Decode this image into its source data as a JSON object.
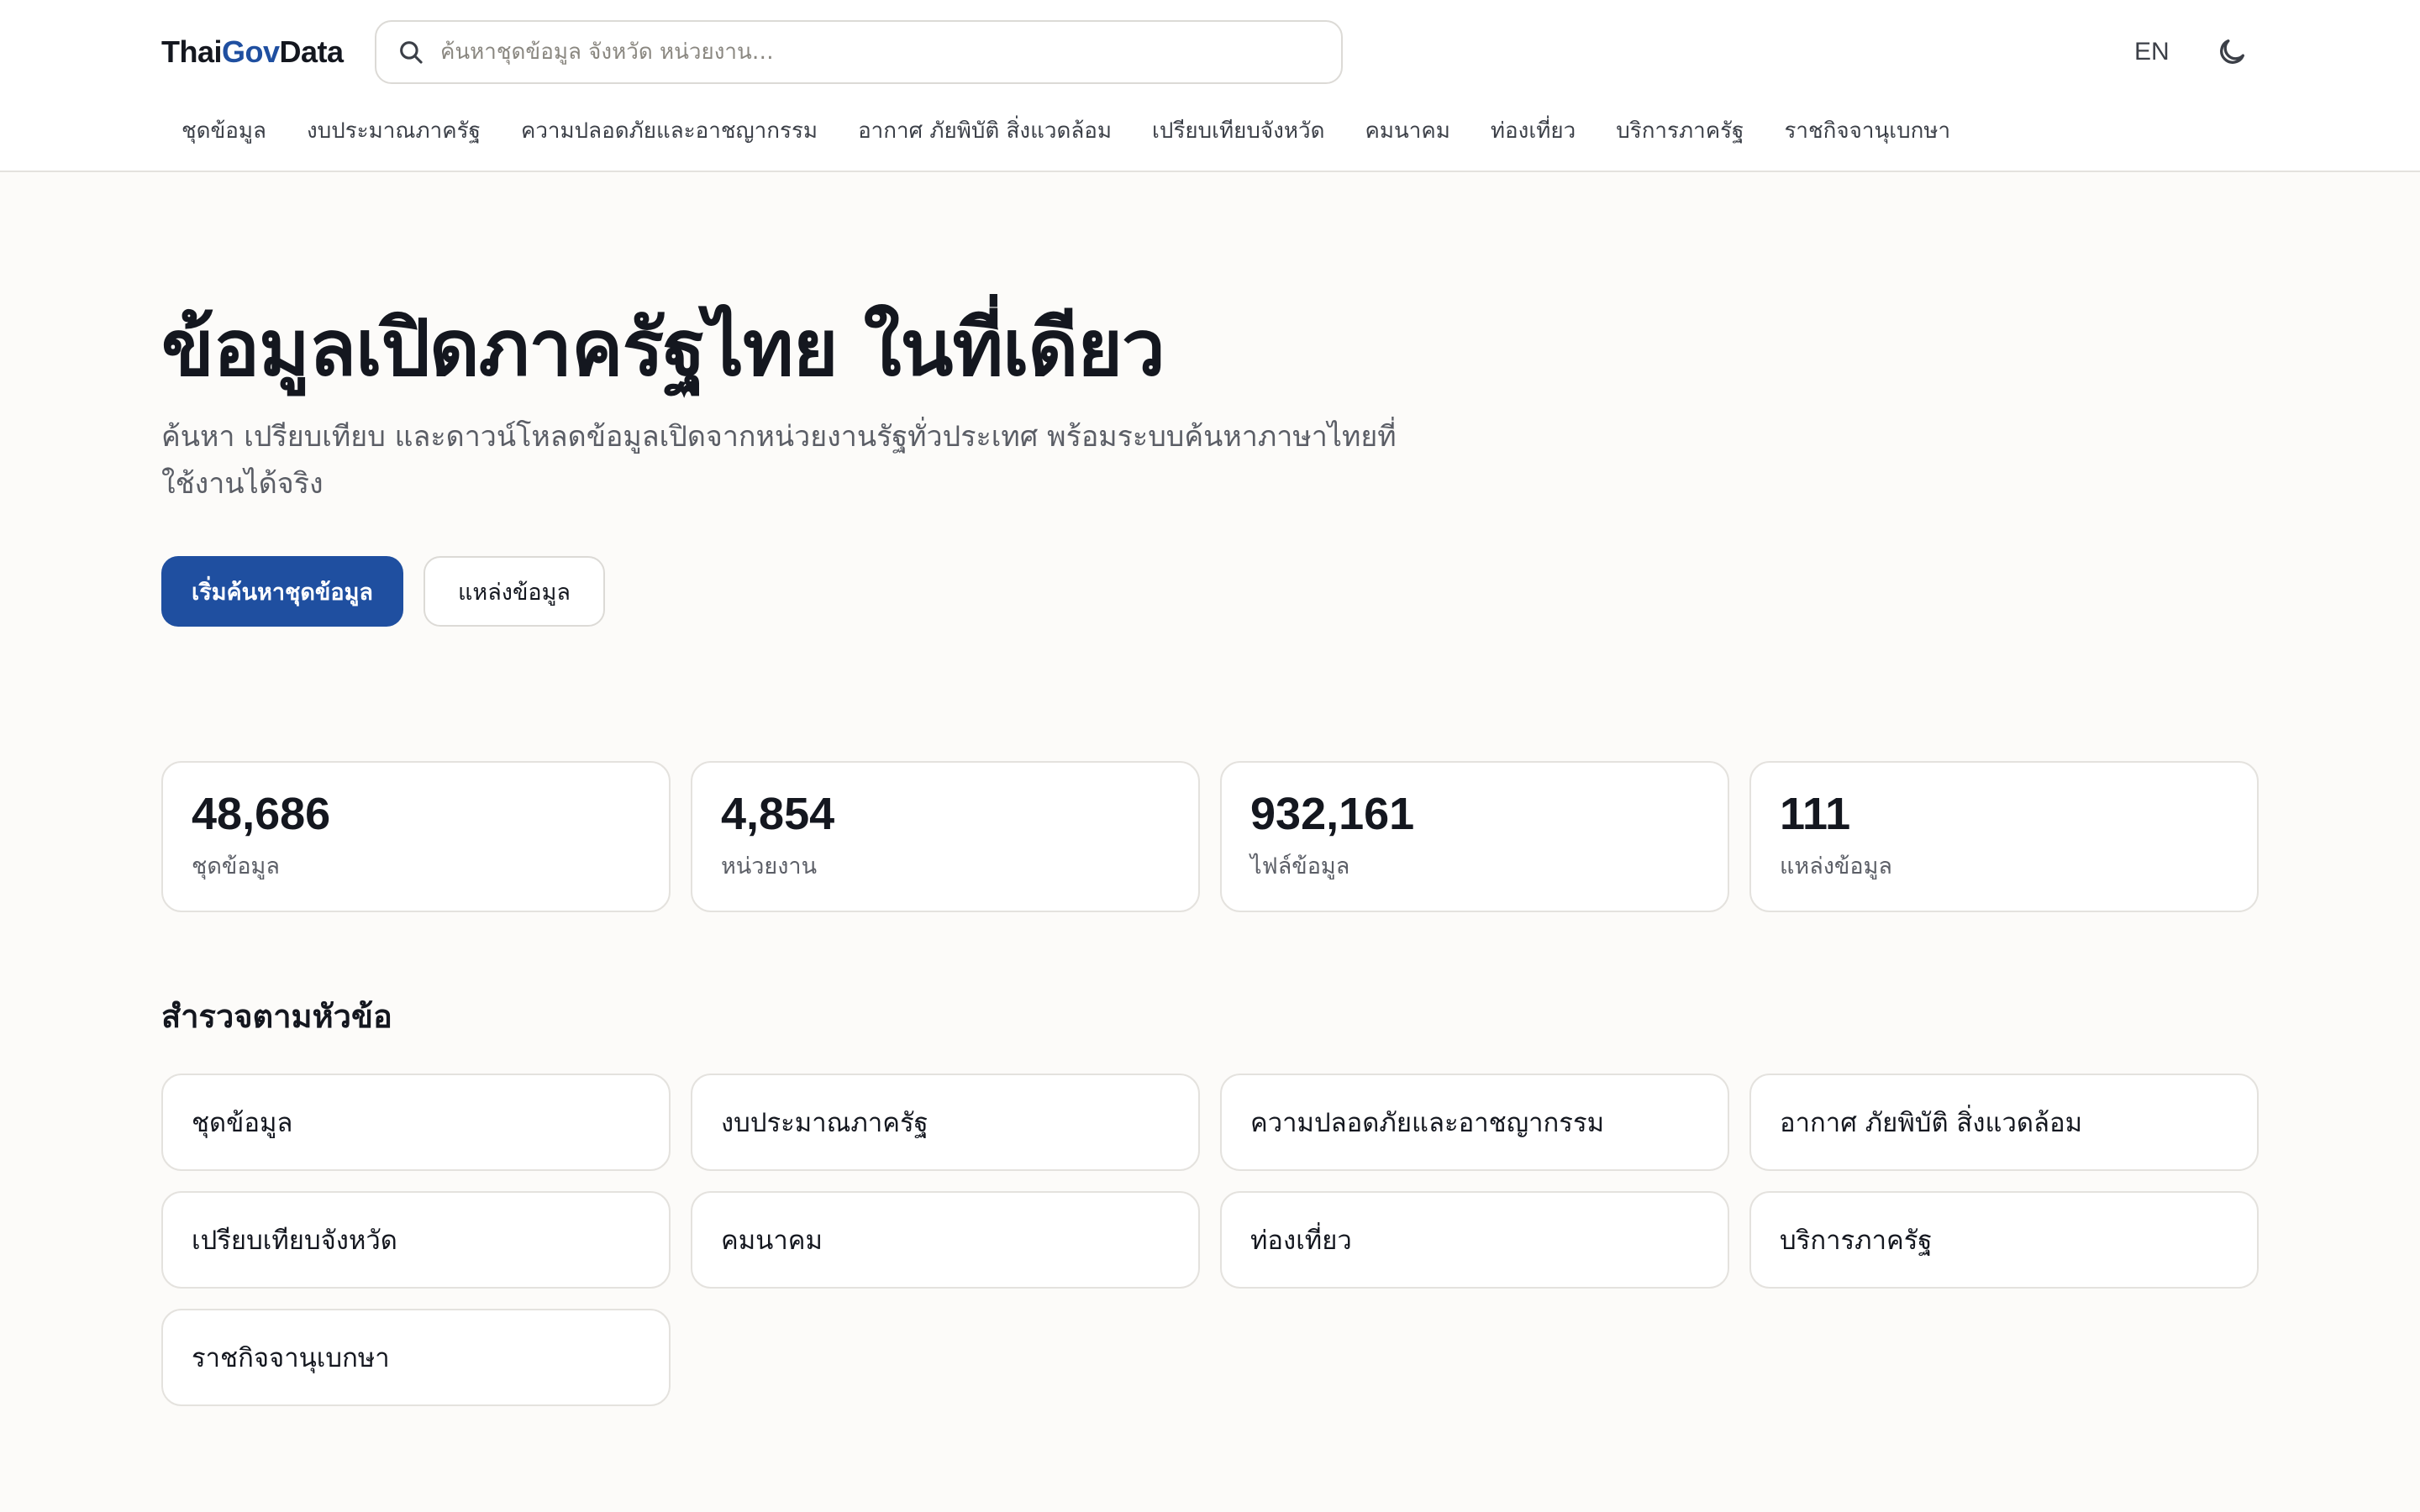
{
  "header": {
    "logo": {
      "part1": "Thai",
      "part2": "Gov",
      "part3": "Data"
    },
    "search_placeholder": "ค้นหาชุดข้อมูล จังหวัด หน่วยงาน…",
    "lang_toggle": "EN",
    "icons": {
      "search": "search-icon",
      "theme": "moon-icon"
    }
  },
  "nav": [
    "ชุดข้อมูล",
    "งบประมาณภาครัฐ",
    "ความปลอดภัยและอาชญากรรม",
    "อากาศ ภัยพิบัติ สิ่งแวดล้อม",
    "เปรียบเทียบจังหวัด",
    "คมนาคม",
    "ท่องเที่ยว",
    "บริการภาครัฐ",
    "ราชกิจจานุเบกษา"
  ],
  "hero": {
    "title": "ข้อมูลเปิดภาครัฐไทย ในที่เดียว",
    "subtitle": "ค้นหา เปรียบเทียบ และดาวน์โหลดข้อมูลเปิดจากหน่วยงานรัฐทั่วประเทศ พร้อมระบบค้นหาภาษาไทยที่ใช้งานได้จริง",
    "primary_button": "เริ่มค้นหาชุดข้อมูล",
    "secondary_button": "แหล่งข้อมูล"
  },
  "stats": [
    {
      "value": "48,686",
      "label": "ชุดข้อมูล"
    },
    {
      "value": "4,854",
      "label": "หน่วยงาน"
    },
    {
      "value": "932,161",
      "label": "ไฟล์ข้อมูล"
    },
    {
      "value": "111",
      "label": "แหล่งข้อมูล"
    }
  ],
  "topics": {
    "title": "สำรวจตามหัวข้อ",
    "items": [
      "ชุดข้อมูล",
      "งบประมาณภาครัฐ",
      "ความปลอดภัยและอาชญากรรม",
      "อากาศ ภัยพิบัติ สิ่งแวดล้อม",
      "เปรียบเทียบจังหวัด",
      "คมนาคม",
      "ท่องเที่ยว",
      "บริการภาครัฐ",
      "ราชกิจจานุเบกษา"
    ]
  },
  "colors": {
    "accent": "#1f4fa0",
    "background": "#fcfbf9",
    "card": "#ffffff",
    "border": "#e4e2de",
    "text": "#14171f",
    "muted": "#5b5e66"
  }
}
